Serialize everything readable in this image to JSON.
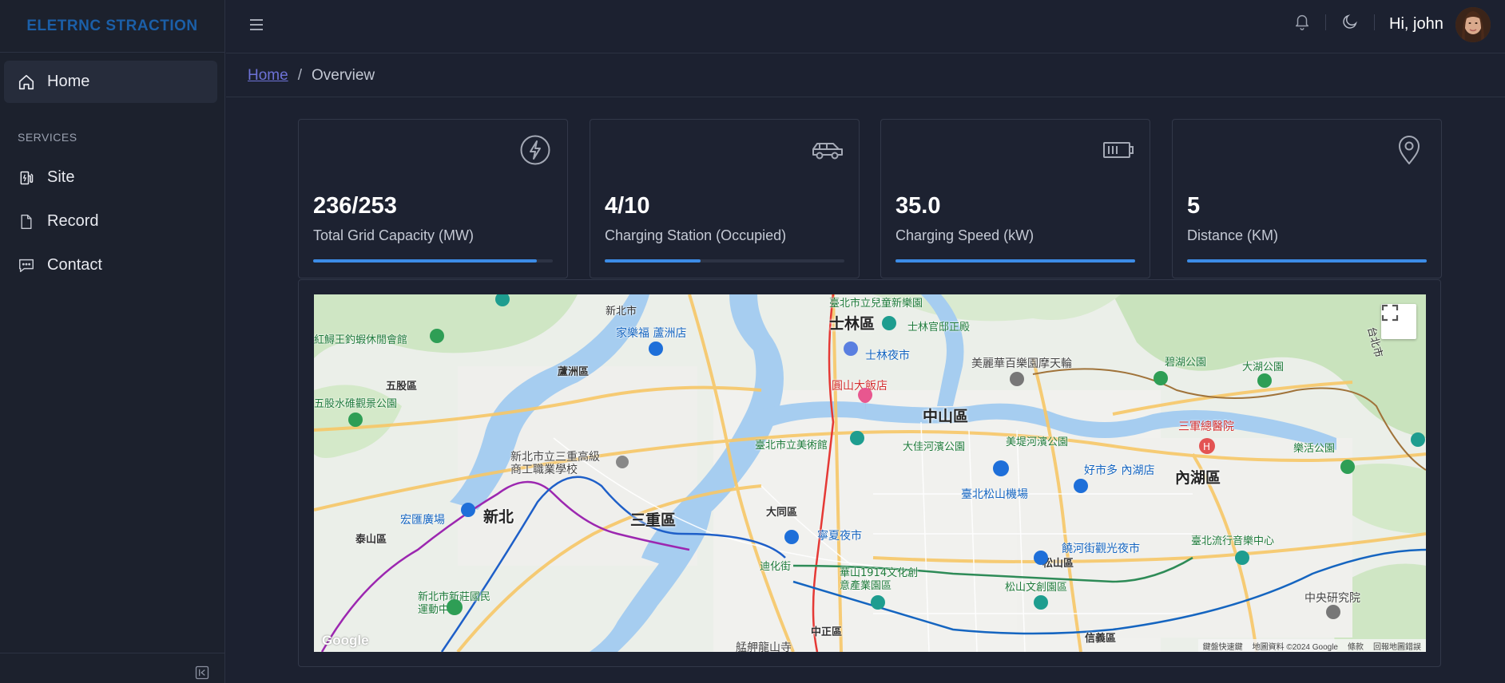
{
  "brand": "ELETRNC STRACTION",
  "sidebar": {
    "items": [
      {
        "label": "Home",
        "icon": "home-icon"
      },
      {
        "label": "Site",
        "icon": "ev-station-icon"
      },
      {
        "label": "Record",
        "icon": "document-icon"
      },
      {
        "label": "Contact",
        "icon": "chat-icon"
      }
    ],
    "section_title": "SERVICES"
  },
  "header": {
    "greeting": "Hi, john"
  },
  "breadcrumb": {
    "home": "Home",
    "separator": "/",
    "current": "Overview"
  },
  "cards": [
    {
      "value": "236/253",
      "label": "Total Grid Capacity (MW)",
      "icon": "lightning-icon",
      "progress": 0.933
    },
    {
      "value": "4/10",
      "label": "Charging Station (Occupied)",
      "icon": "car-icon",
      "progress": 0.4
    },
    {
      "value": "35.0",
      "label": "Charging Speed (kW)",
      "icon": "battery-icon",
      "progress": 1.0
    },
    {
      "value": "5",
      "label": "Distance (KM)",
      "icon": "location-pin-icon",
      "progress": 1.0
    }
  ],
  "map": {
    "labels": {
      "shilin": "士林區",
      "zhongshan": "中山區",
      "neihu": "內湖區",
      "sanchong": "三重區",
      "xinbei": "新北",
      "luzhou": "蘆洲區",
      "wugu": "五股區",
      "taishan": "泰山區",
      "datong": "大同區",
      "songshan": "松山區",
      "zhongzheng": "中正區",
      "xinyi": "信義區",
      "xinbei_city": "新北市",
      "taibei_city": "台北市"
    },
    "pois": {
      "grand_hotel": "圓山大飯店",
      "tri_service": "三軍總醫院",
      "songshan_airport": "臺北松山機場",
      "fine_arts": "臺北市立美術館",
      "dajia_park": "大佳河濱公園",
      "meiti_park": "美堤河濱公園",
      "costco": "好市多 內湖店",
      "carrefour": "家樂福 蘆洲店",
      "huashan": "華山1914文化創意產業園區",
      "songshan_park": "松山文創園區",
      "raohe": "饒河街觀光夜市",
      "ningxia": "寧夏夜市",
      "shilin_market": "士林夜市",
      "shilin_residence": "士林官邸正殿",
      "bihu_park": "碧湖公園",
      "dahu_park": "大湖公園",
      "leqing_park": "樂活公園",
      "hongxiang": "宏匯廣場",
      "xinzhuang_sports": "新北市新莊國民運動中心",
      "sanchong_school": "新北市立三重高級商工職業學校",
      "music_center": "臺北流行音樂中心",
      "miramar": "美麗華百樂園摩天輪",
      "children_park": "臺北市立兒童新樂園",
      "academia": "中央研究院",
      "wugu_park": "五股水碓觀景公園",
      "eel_fishing": "紅鱘王釣蝦休閒會館",
      "dihua": "迪化街",
      "mengjia": "艋舺龍山寺"
    },
    "footer": [
      "鍵盤快速鍵",
      "地圖資料 ©2024 Google",
      "條款",
      "回報地圖錯誤"
    ],
    "google": "Google"
  },
  "colors": {
    "accent": "#3c8ce7",
    "brand": "#1b5fa8",
    "background": "#1c2130"
  }
}
